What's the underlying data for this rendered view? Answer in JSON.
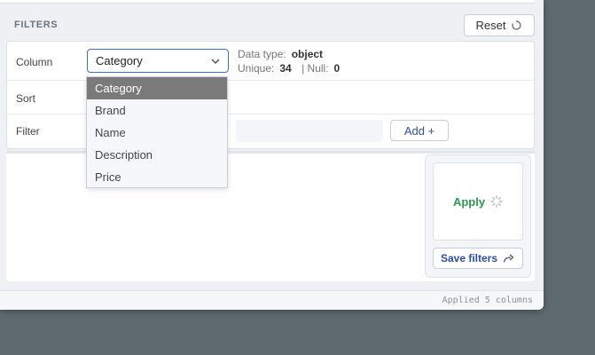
{
  "filters": {
    "title": "FILTERS",
    "reset_label": "Reset",
    "rows": {
      "column_label": "Column",
      "sort_label": "Sort",
      "filter_label": "Filter"
    },
    "column_select": {
      "value": "Category",
      "options": [
        "Category",
        "Brand",
        "Name",
        "Description",
        "Price"
      ],
      "selected_index": 0
    },
    "meta": {
      "data_type_label": "Data type:",
      "data_type_value": "object",
      "unique_label": "Unique:",
      "unique_value": "34",
      "null_label": "| Null:",
      "null_value": "0"
    },
    "add_label": "Add +",
    "apply_label": "Apply",
    "save_label": "Save filters"
  },
  "status": {
    "text": "Applied 5 columns"
  },
  "colors": {
    "accent_blue": "#2a4db0",
    "focus_blue": "#3a6fd8",
    "apply_green": "#2a9a4f",
    "selected_option_bg": "#7a7a7a"
  },
  "icons": {
    "reset": "reset-icon",
    "chevron": "chevron-down-icon",
    "spinner": "spinner-icon",
    "share": "share-arrow-icon"
  }
}
